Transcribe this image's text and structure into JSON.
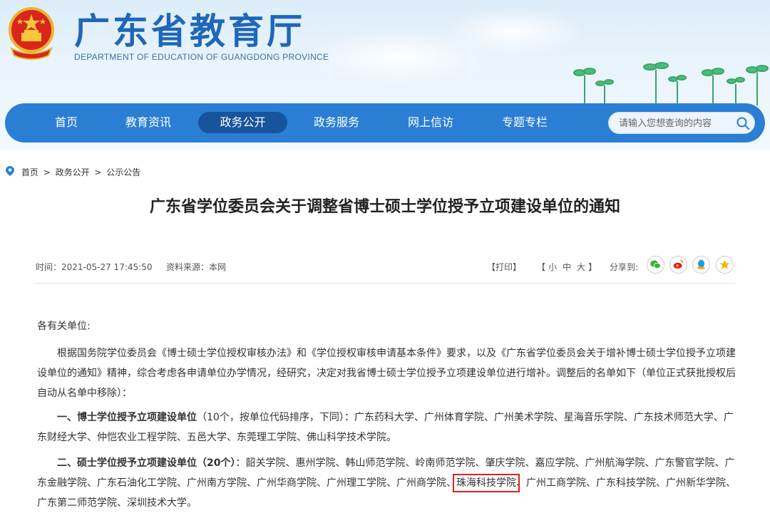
{
  "header": {
    "title": "广东省教育厅",
    "subtitle": "DEPARTMENT OF EDUCATION OF GUANGDONG PROVINCE"
  },
  "nav": {
    "items": [
      {
        "label": "首页",
        "active": false
      },
      {
        "label": "教育资讯",
        "active": false
      },
      {
        "label": "政务公开",
        "active": true
      },
      {
        "label": "政务服务",
        "active": false
      },
      {
        "label": "网上信访",
        "active": false
      },
      {
        "label": "专题专栏",
        "active": false
      }
    ],
    "search_placeholder": "请输入您想查询的内容"
  },
  "breadcrumb": [
    "首页",
    "政务公开",
    "公示公告"
  ],
  "article": {
    "title": "广东省学位委员会关于调整省博士硕士学位授予立项建设单位的通知",
    "time": "时间：2021-05-27 17:45:50",
    "source": "资料来源：本网",
    "print": "【打印】",
    "font_size": {
      "open": "【",
      "small": "小",
      "medium": "中",
      "large": "大",
      "close": "】"
    },
    "share_label": "分享到:",
    "share_icons": [
      "wechat-icon",
      "weibo-icon",
      "qq-icon",
      "qzone-icon"
    ],
    "greeting": "各有关单位:",
    "intro": "根据国务院学位委员会《博士硕士学位授权审核办法》和《学位授权审核申请基本条件》要求，以及《广东省学位委员会关于增补博士硕士学位授予立项建设单位的通知》精神，综合考虑各申请单位办学情况，经研究，决定对我省博士硕士学位授予立项建设单位进行增补。调整后的名单如下（单位正式获批授权后自动从名单中移除）：",
    "section1_heading": "一、博士学位授予立项建设单位",
    "section1_text": "（10个，按单位代码排序，下同）：广东药科大学、广州体育学院、广州美术学院、星海音乐学院、广东技术师范大学、广东财经大学、仲恺农业工程学院、五邑大学、东莞理工学院、佛山科学技术学院。",
    "section2_heading": "二、硕士学位授予立项建设单位（20个）",
    "section2_text_before": "：韶关学院、惠州学院、韩山师范学院、岭南师范学院、肇庆学院、嘉应学院、广州航海学院、广东警官学院、广东金融学院、广东石油化工学院、广州南方学院、广州华商学院、广州理工学院、广州商学院、",
    "section2_highlight": "珠海科技学院",
    "section2_text_after": "、广州工商学院、广东科技学院、广州新华学院、广东第二师范学院、深圳技术大学。"
  }
}
